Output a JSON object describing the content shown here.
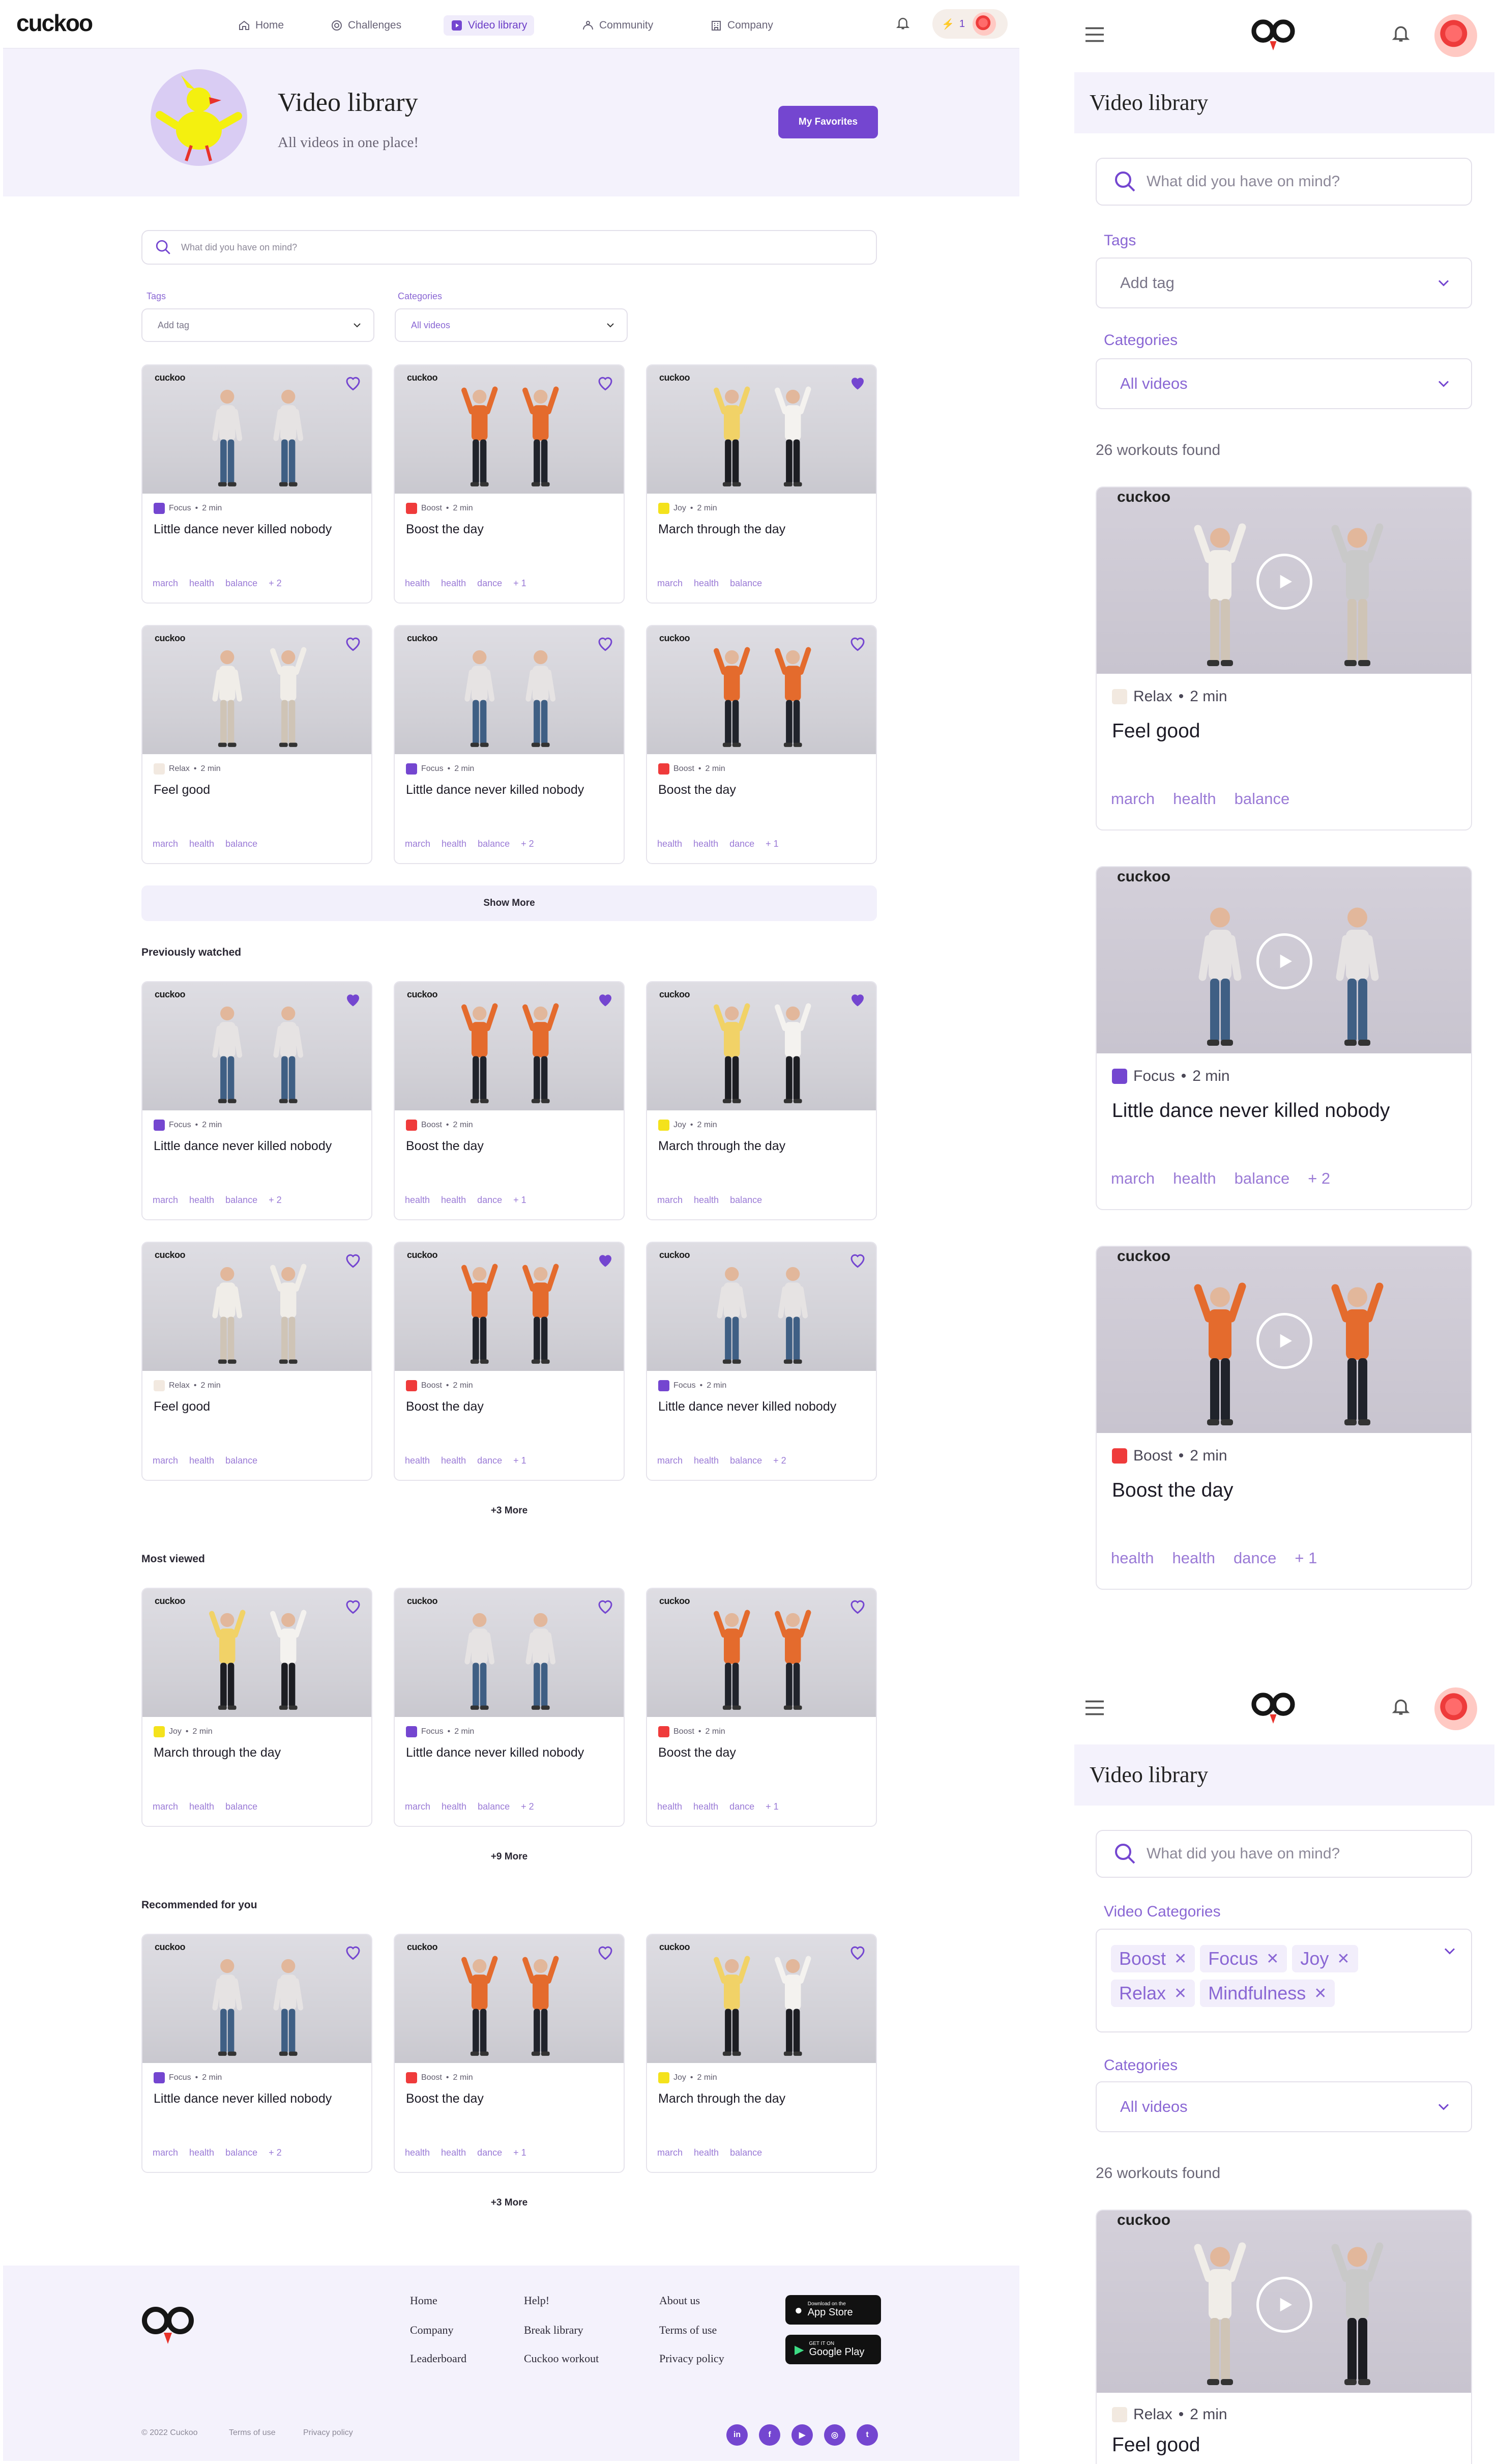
{
  "nav": {
    "logo": "cuckoo",
    "items": [
      {
        "label": "Home",
        "icon": "home-icon"
      },
      {
        "label": "Challenges",
        "icon": "target-icon"
      },
      {
        "label": "Video library",
        "icon": "video-icon"
      },
      {
        "label": "Community",
        "icon": "community-icon"
      },
      {
        "label": "Company",
        "icon": "building-icon"
      }
    ],
    "streak_count": "1"
  },
  "hero": {
    "title": "Video library",
    "subtitle": "All videos in one place!",
    "favorites_label": "My Favorites"
  },
  "search": {
    "placeholder": "What did you have on mind?"
  },
  "filters": {
    "tags_label": "Tags",
    "tags_placeholder": "Add tag",
    "categories_label": "Categories",
    "categories_value": "All videos"
  },
  "colors": {
    "focus": "#7446d0",
    "boost": "#ef3b3b",
    "joy": "#f4e21c",
    "relax": "#f2e9e0",
    "accent": "#7446d0"
  },
  "card_brand": "cuckoo",
  "library_cards": [
    {
      "cat": "Focus",
      "dur": "2 min",
      "title": "Little dance never killed nobody",
      "tags": [
        "march",
        "health",
        "balance",
        "+ 2"
      ],
      "fav": false
    },
    {
      "cat": "Boost",
      "dur": "2 min",
      "title": "Boost the day",
      "tags": [
        "health",
        "health",
        "dance",
        "+ 1"
      ],
      "fav": false
    },
    {
      "cat": "Joy",
      "dur": "2 min",
      "title": "March through the day",
      "tags": [
        "march",
        "health",
        "balance"
      ],
      "fav": true
    },
    {
      "cat": "Relax",
      "dur": "2 min",
      "title": "Feel good",
      "tags": [
        "march",
        "health",
        "balance"
      ],
      "fav": false
    },
    {
      "cat": "Focus",
      "dur": "2 min",
      "title": "Little dance never killed nobody",
      "tags": [
        "march",
        "health",
        "balance",
        "+ 2"
      ],
      "fav": false
    },
    {
      "cat": "Boost",
      "dur": "2 min",
      "title": "Boost the day",
      "tags": [
        "health",
        "health",
        "dance",
        "+ 1"
      ],
      "fav": false
    }
  ],
  "show_more_label": "Show More",
  "previously_watched": {
    "title": "Previously watched",
    "more": "+3 More",
    "cards": [
      {
        "cat": "Focus",
        "dur": "2 min",
        "title": "Little dance never killed nobody",
        "tags": [
          "march",
          "health",
          "balance",
          "+ 2"
        ],
        "fav": true
      },
      {
        "cat": "Boost",
        "dur": "2 min",
        "title": "Boost the day",
        "tags": [
          "health",
          "health",
          "dance",
          "+ 1"
        ],
        "fav": true
      },
      {
        "cat": "Joy",
        "dur": "2 min",
        "title": "March through the day",
        "tags": [
          "march",
          "health",
          "balance"
        ],
        "fav": true
      },
      {
        "cat": "Relax",
        "dur": "2 min",
        "title": "Feel good",
        "tags": [
          "march",
          "health",
          "balance"
        ],
        "fav": false
      },
      {
        "cat": "Boost",
        "dur": "2 min",
        "title": "Boost the day",
        "tags": [
          "health",
          "health",
          "dance",
          "+ 1"
        ],
        "fav": true
      },
      {
        "cat": "Focus",
        "dur": "2 min",
        "title": "Little dance never killed nobody",
        "tags": [
          "march",
          "health",
          "balance",
          "+ 2"
        ],
        "fav": false
      }
    ]
  },
  "most_viewed": {
    "title": "Most viewed",
    "more": "+9 More",
    "cards": [
      {
        "cat": "Joy",
        "dur": "2 min",
        "title": "March through the day",
        "tags": [
          "march",
          "health",
          "balance"
        ],
        "fav": false
      },
      {
        "cat": "Focus",
        "dur": "2 min",
        "title": "Little dance never killed nobody",
        "tags": [
          "march",
          "health",
          "balance",
          "+ 2"
        ],
        "fav": false
      },
      {
        "cat": "Boost",
        "dur": "2 min",
        "title": "Boost the day",
        "tags": [
          "health",
          "health",
          "dance",
          "+ 1"
        ],
        "fav": false
      }
    ]
  },
  "recommended": {
    "title": "Recommended for you",
    "more": "+3 More",
    "cards": [
      {
        "cat": "Focus",
        "dur": "2 min",
        "title": "Little dance never killed nobody",
        "tags": [
          "march",
          "health",
          "balance",
          "+ 2"
        ],
        "fav": false
      },
      {
        "cat": "Boost",
        "dur": "2 min",
        "title": "Boost the day",
        "tags": [
          "health",
          "health",
          "dance",
          "+ 1"
        ],
        "fav": false
      },
      {
        "cat": "Joy",
        "dur": "2 min",
        "title": "March through the day",
        "tags": [
          "march",
          "health",
          "balance"
        ],
        "fav": false
      }
    ]
  },
  "footer": {
    "col1": [
      "Home",
      "Company",
      "Leaderboard"
    ],
    "col2": [
      "Help!",
      "Break library",
      "Cuckoo workout"
    ],
    "col3": [
      "About us",
      "Terms of use",
      "Privacy policy"
    ],
    "appstore_small": "Download on the",
    "appstore_big": "App Store",
    "gplay_small": "GET IT ON",
    "gplay_big": "Google Play",
    "copyright": "© 2022 Cuckoo",
    "terms": "Terms of use",
    "privacy": "Privacy policy",
    "social": [
      "in",
      "f",
      "▶",
      "◎",
      "t"
    ]
  },
  "mobile1": {
    "title": "Video library",
    "search_placeholder": "What did you have on mind?",
    "tags_label": "Tags",
    "tags_placeholder": "Add tag",
    "categories_label": "Categories",
    "categories_value": "All videos",
    "found": "26 workouts found",
    "cards": [
      {
        "cat": "Relax",
        "dur": "2 min",
        "title": "Feel good",
        "tags": [
          "march",
          "health",
          "balance"
        ]
      },
      {
        "cat": "Focus",
        "dur": "2 min",
        "title": "Little dance never killed nobody",
        "tags": [
          "march",
          "health",
          "balance",
          "+ 2"
        ]
      },
      {
        "cat": "Boost",
        "dur": "2 min",
        "title": "Boost the day",
        "tags": [
          "health",
          "health",
          "dance",
          "+ 1"
        ]
      }
    ]
  },
  "mobile2": {
    "title": "Video library",
    "search_placeholder": "What did you have on mind?",
    "video_categories_label": "Video Categories",
    "chips": [
      "Boost",
      "Focus",
      "Joy",
      "Relax",
      "Mindfulness"
    ],
    "categories_label": "Categories",
    "categories_value": "All videos",
    "found": "26 workouts found",
    "card": {
      "cat": "Relax",
      "dur": "2 min",
      "title": "Feel good"
    }
  }
}
